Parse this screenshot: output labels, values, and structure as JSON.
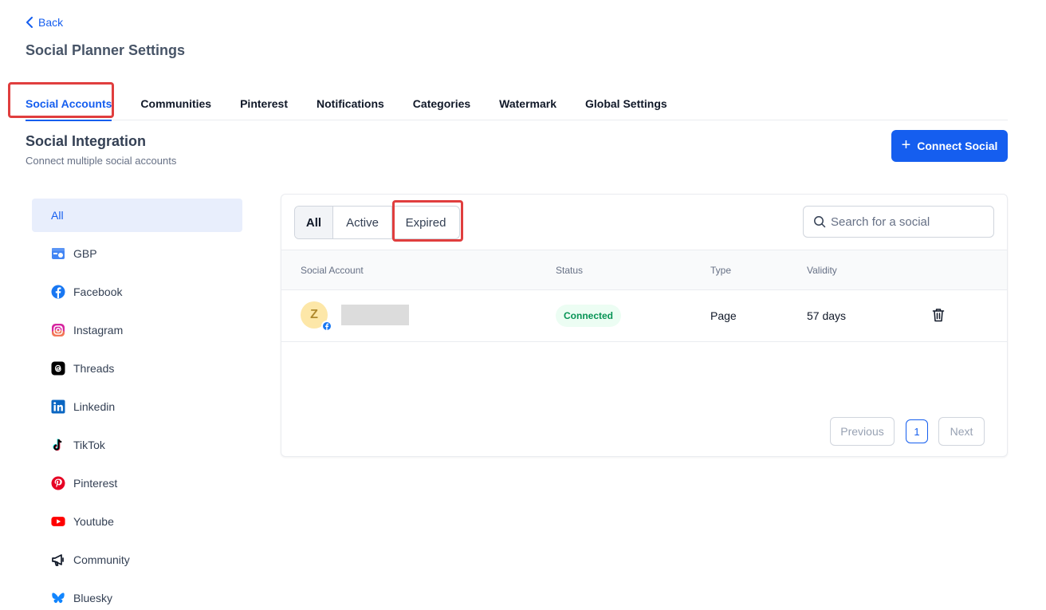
{
  "header": {
    "back_label": "Back",
    "title": "Social Planner Settings"
  },
  "tabs": [
    {
      "label": "Social Accounts",
      "active": true
    },
    {
      "label": "Communities"
    },
    {
      "label": "Pinterest"
    },
    {
      "label": "Notifications"
    },
    {
      "label": "Categories"
    },
    {
      "label": "Watermark"
    },
    {
      "label": "Global Settings"
    }
  ],
  "section": {
    "title": "Social Integration",
    "subtitle": "Connect multiple social accounts"
  },
  "connect_button": {
    "label": "Connect Social",
    "icon": "plus-icon"
  },
  "sidebar": {
    "items": [
      {
        "label": "All",
        "active": true
      },
      {
        "label": "GBP",
        "icon": "gbp-icon"
      },
      {
        "label": "Facebook",
        "icon": "facebook-icon"
      },
      {
        "label": "Instagram",
        "icon": "instagram-icon"
      },
      {
        "label": "Threads",
        "icon": "threads-icon"
      },
      {
        "label": "Linkedin",
        "icon": "linkedin-icon"
      },
      {
        "label": "TikTok",
        "icon": "tiktok-icon"
      },
      {
        "label": "Pinterest",
        "icon": "pinterest-icon"
      },
      {
        "label": "Youtube",
        "icon": "youtube-icon"
      },
      {
        "label": "Community",
        "icon": "megaphone-icon"
      },
      {
        "label": "Bluesky",
        "icon": "bluesky-icon"
      }
    ]
  },
  "filter": {
    "segments": [
      {
        "label": "All",
        "active": true
      },
      {
        "label": "Active"
      },
      {
        "label": "Expired"
      }
    ],
    "search_placeholder": "Search for a social"
  },
  "table": {
    "columns": [
      "Social Account",
      "Status",
      "Type",
      "Validity"
    ],
    "rows": [
      {
        "avatar_letter": "Z",
        "network_icon": "facebook-icon",
        "status": "Connected",
        "type": "Page",
        "validity": "57 days"
      }
    ]
  },
  "pagination": {
    "previous": "Previous",
    "page": "1",
    "next": "Next"
  },
  "colors": {
    "primary": "#155eef",
    "highlight": "#e03e3e",
    "success": "#079455"
  }
}
